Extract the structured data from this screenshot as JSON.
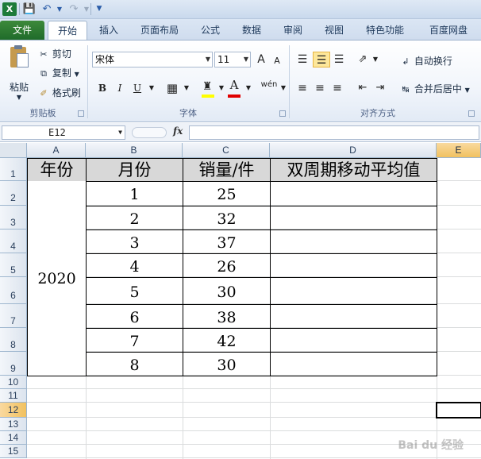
{
  "ribbon_tabs": [
    "文件",
    "开始",
    "插入",
    "页面布局",
    "公式",
    "数据",
    "审阅",
    "视图",
    "特色功能",
    "百度网盘"
  ],
  "clipboard": {
    "paste": "粘贴",
    "cut": "剪切",
    "copy": "复制",
    "format_painter": "格式刷",
    "group_label": "剪贴板"
  },
  "font": {
    "name": "宋体",
    "size": "11",
    "bold": "B",
    "italic": "I",
    "underline": "U",
    "grow": "A",
    "shrink": "A",
    "font_color_letter": "A",
    "phonetic": "wén",
    "group_label": "字体"
  },
  "alignment": {
    "wrap_text": "自动换行",
    "merge_center": "合并后居中",
    "group_label": "对齐方式"
  },
  "formula_bar": {
    "name_box": "E12",
    "fx": "fx",
    "formula": ""
  },
  "columns": [
    "A",
    "B",
    "C",
    "D",
    "E"
  ],
  "rows": [
    "1",
    "2",
    "3",
    "4",
    "5",
    "6",
    "7",
    "8",
    "9",
    "10",
    "11",
    "12",
    "13",
    "14",
    "15"
  ],
  "table": {
    "headers": [
      "年份",
      "月份",
      "销量/件",
      "双周期移动平均值"
    ],
    "year": "2020",
    "months": [
      "1",
      "2",
      "3",
      "4",
      "5",
      "6",
      "7",
      "8"
    ],
    "sales": [
      "25",
      "32",
      "37",
      "26",
      "30",
      "38",
      "42",
      "30"
    ]
  },
  "selected_cell": "E12",
  "watermark": "Bai du 经验"
}
